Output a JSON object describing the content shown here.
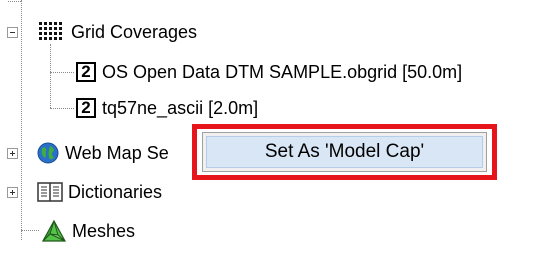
{
  "tree": {
    "grid_coverages": {
      "label": "Grid Coverages",
      "icon": "grid-dots-icon",
      "expanded": true,
      "children": [
        {
          "badge": "2",
          "label": "OS Open Data DTM SAMPLE.obgrid [50.0m]",
          "icon": "grid-2-icon"
        },
        {
          "badge": "2",
          "label": "tq57ne_ascii [2.0m]",
          "icon": "grid-2-icon"
        }
      ]
    },
    "web_map_services": {
      "label": "Web Map Se",
      "icon": "globe-icon",
      "expanded": false
    },
    "dictionaries": {
      "label": "Dictionaries",
      "icon": "book-icon",
      "expanded": false
    },
    "meshes": {
      "label": "Meshes",
      "icon": "mesh-icon"
    }
  },
  "context_menu": {
    "items": [
      {
        "label": "Set As 'Model Cap'"
      }
    ],
    "highlight_color": "#e8141c"
  }
}
